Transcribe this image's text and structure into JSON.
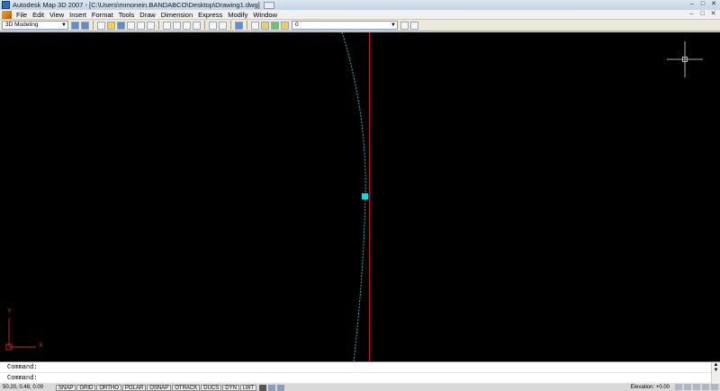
{
  "titlebar": {
    "title": "Autodesk Map 3D 2007 - [C:\\Users\\mmonein.BANDABCO\\Desktop\\Drawing1.dwg]",
    "minimize": "–",
    "maximize": "□",
    "close": "✕"
  },
  "menubar": {
    "items": [
      "File",
      "Edit",
      "View",
      "Insert",
      "Format",
      "Tools",
      "Draw",
      "Dimension",
      "Express",
      "Modify",
      "Window"
    ],
    "doc_minimize": "–",
    "doc_restore": "□",
    "doc_close": "✕"
  },
  "toolbar": {
    "workspace": "3D Modeling",
    "layer": "0"
  },
  "command": {
    "line1": "Command:",
    "line2": "Command:"
  },
  "status": {
    "coords": "50.20, 0.48, 0.00",
    "toggles": [
      "SNAP",
      "GRID",
      "ORTHO",
      "POLAR",
      "OSNAP",
      "OTRACK",
      "DUCS",
      "DYN",
      "LWT"
    ],
    "elevation": "Elevation: +0.00"
  },
  "ucs": {
    "x_label": "X",
    "y_label": "Y"
  },
  "colors": {
    "canvas": "#000000",
    "arc": "#28c8c8",
    "red_line": "#c01818",
    "grip": "#00e0e0",
    "ucs": "#d02828"
  }
}
